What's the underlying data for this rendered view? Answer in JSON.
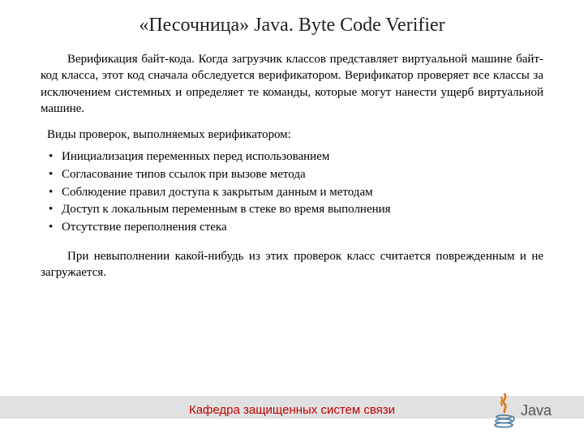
{
  "title": "«Песочница» Java. Byte Code Verifier",
  "intro": "Верификация байт-кода. Когда загрузчик классов представляет виртуальной машине байт-код класса, этот код сначала обследуется верификатором. Верификатор проверяет все классы за исключением системных и определяет те команды, которые могут нанести ущерб виртуальной машине.",
  "lead": "Виды проверок, выполняемых верификатором:",
  "bullets": [
    "Инициализация переменных перед использованием",
    "Согласование типов ссылок при вызове метода",
    "Соблюдение правил доступа к закрытым данным и методам",
    "Доступ к локальным переменным в стеке во время выполнения",
    "Отсутствие переполнения стека"
  ],
  "outro": "При невыполнении какой-нибудь из этих проверок класс считается поврежденным и не загружается.",
  "footer": "Кафедра защищенных систем связи",
  "logo_text": "Java"
}
